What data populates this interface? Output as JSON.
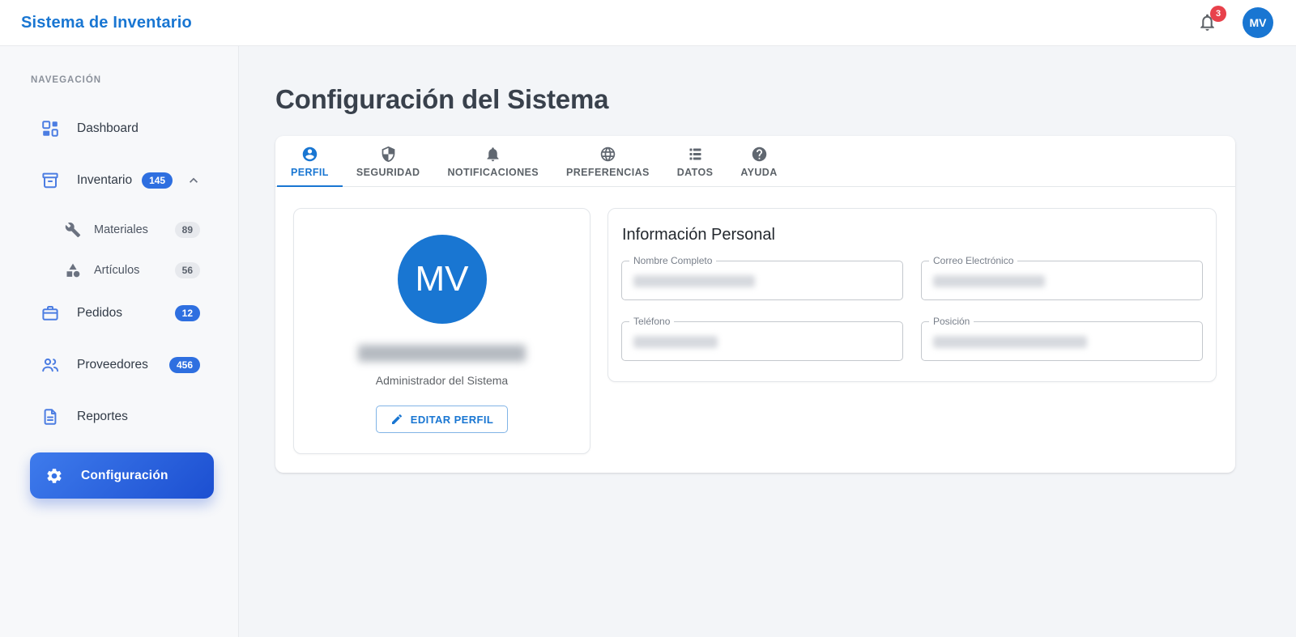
{
  "app": {
    "title": "Sistema de Inventario"
  },
  "header": {
    "notification_count": "3",
    "avatar_initials": "MV"
  },
  "sidebar": {
    "section_label": "NAVEGACIÓN",
    "items": [
      {
        "label": "Dashboard",
        "icon": "dashboard-icon",
        "badge": ""
      },
      {
        "label": "Inventario",
        "icon": "inventory-box-icon",
        "badge": "145",
        "expanded": true
      },
      {
        "label": "Materiales",
        "icon": "wrench-icon",
        "badge": "89"
      },
      {
        "label": "Artículos",
        "icon": "category-shapes-icon",
        "badge": "56"
      },
      {
        "label": "Pedidos",
        "icon": "briefcase-icon",
        "badge": "12"
      },
      {
        "label": "Proveedores",
        "icon": "people-icon",
        "badge": "456"
      },
      {
        "label": "Reportes",
        "icon": "document-icon",
        "badge": ""
      },
      {
        "label": "Configuración",
        "icon": "gear-icon",
        "badge": "",
        "active": true
      }
    ]
  },
  "main": {
    "page_title": "Configuración del Sistema",
    "tabs": [
      {
        "label": "PERFIL",
        "icon": "account-circle-icon",
        "active": true
      },
      {
        "label": "SEGURIDAD",
        "icon": "shield-icon",
        "active": false
      },
      {
        "label": "NOTIFICACIONES",
        "icon": "bell-icon",
        "active": false
      },
      {
        "label": "PREFERENCIAS",
        "icon": "globe-icon",
        "active": false
      },
      {
        "label": "DATOS",
        "icon": "storage-icon",
        "active": false
      },
      {
        "label": "AYUDA",
        "icon": "help-icon",
        "active": false
      }
    ],
    "profile_card": {
      "avatar_initials": "MV",
      "name_redacted": true,
      "role": "Administrador del Sistema",
      "edit_button_label": "EDITAR PERFIL"
    },
    "info_card": {
      "title": "Información Personal",
      "fields": [
        {
          "label": "Nombre Completo",
          "value_redacted": true
        },
        {
          "label": "Correo Electrónico",
          "value_redacted": true
        },
        {
          "label": "Teléfono",
          "value_redacted": true
        },
        {
          "label": "Posición",
          "value_redacted": true
        }
      ]
    }
  },
  "colors": {
    "primary": "#1976d2",
    "sidebar_icon_blue": "#4c7de2",
    "badge_blue": "#2e6fe0",
    "badge_red": "#e8414b",
    "active_gradient_start": "#3e7bec",
    "active_gradient_end": "#1c4fd1"
  }
}
